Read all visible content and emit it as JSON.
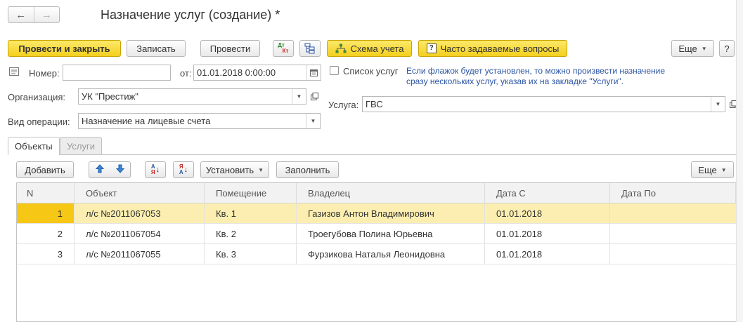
{
  "window": {
    "title": "Назначение услуг (создание) *"
  },
  "toolbar": {
    "post_close": "Провести и закрыть",
    "save": "Записать",
    "post": "Провести",
    "dt_kt_top": "Дт",
    "dt_kt_bottom": "Кт",
    "scheme": "Схема учета",
    "faq": "Часто задаваемые вопросы",
    "more": "Еще",
    "help": "?"
  },
  "form": {
    "number_label": "Номер:",
    "number_value": "",
    "date_label": "от:",
    "date_value": "01.01.2018  0:00:00",
    "org_label": "Организация:",
    "org_value": "УК \"Престиж\"",
    "optype_label": "Вид операции:",
    "optype_value": "Назначение на лицевые счета",
    "services_list_label": "Список услуг",
    "services_list_checked": false,
    "hint_line1": "Если флажок будет установлен, то можно произвести назначение",
    "hint_line2": "сразу нескольких услуг, указав их на закладке \"Услуги\".",
    "service_label": "Услуга:",
    "service_value": "ГВС"
  },
  "tabs": [
    {
      "label": "Объекты",
      "active": true
    },
    {
      "label": "Услуги",
      "active": false
    }
  ],
  "table_toolbar": {
    "add": "Добавить",
    "sort_asc_top": "А",
    "sort_asc_bottom": "Я",
    "sort_desc_top": "Я",
    "sort_desc_bottom": "А",
    "set": "Установить",
    "fill": "Заполнить",
    "more": "Еще"
  },
  "table": {
    "columns": [
      "N",
      "Объект",
      "Помещение",
      "Владелец",
      "Дата С",
      "Дата По"
    ],
    "rows": [
      {
        "n": "1",
        "object": "л/с №2011067053",
        "room": "Кв. 1",
        "owner": "Газизов Антон Владимирович",
        "date_from": "01.01.2018",
        "date_to": "",
        "selected": true
      },
      {
        "n": "2",
        "object": "л/с №2011067054",
        "room": "Кв. 2",
        "owner": "Троегубова Полина Юрьевна",
        "date_from": "01.01.2018",
        "date_to": "",
        "selected": false
      },
      {
        "n": "3",
        "object": "л/с №2011067055",
        "room": "Кв. 3",
        "owner": "Фурзикова Наталья Леонидовна",
        "date_from": "01.01.2018",
        "date_to": "",
        "selected": false
      }
    ]
  },
  "colors": {
    "accent_yellow": "#f6c715",
    "selected_row": "#fbeeb0",
    "hint_blue": "#2b54a3"
  }
}
